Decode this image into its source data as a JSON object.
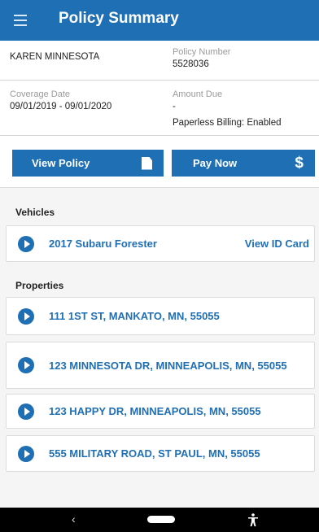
{
  "header": {
    "title": "Policy Summary"
  },
  "summary": {
    "insured_name": "KAREN MINNESOTA",
    "policy_number_label": "Policy Number",
    "policy_number": "5528036",
    "coverage_date_label": "Coverage Date",
    "coverage_date": "09/01/2019 - 09/01/2020",
    "amount_due_label": "Amount Due",
    "amount_due": "-",
    "paperless_billing": "Paperless Billing: Enabled"
  },
  "actions": {
    "view_policy": "View Policy",
    "pay_now": "Pay Now"
  },
  "vehicles": {
    "header": "Vehicles",
    "items": [
      {
        "name": "2017 Subaru Forester",
        "link": "View ID Card"
      }
    ]
  },
  "properties": {
    "header": "Properties",
    "items": [
      "111 1ST ST, MANKATO, MN, 55055",
      "123 MINNESOTA DR, MINNEAPOLIS, MN, 55055",
      "123 HAPPY DR, MINNEAPOLIS, MN, 55055",
      "555 MILITARY ROAD, ST PAUL, MN, 55055"
    ]
  },
  "icons": {
    "menu": "hamburger-menu-icon",
    "document": "document-icon",
    "dollar": "dollar-icon",
    "play": "play-circle-icon",
    "accent": "#1f6fb5"
  }
}
